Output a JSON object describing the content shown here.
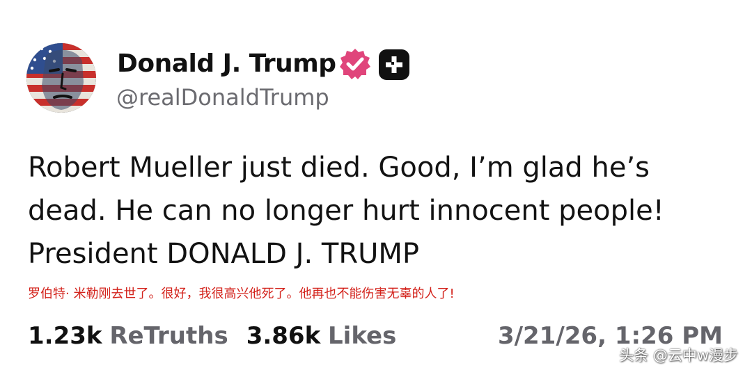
{
  "profile": {
    "display_name": "Donald J. Trump",
    "handle": "@realDonaldTrump",
    "verified_color": "#e0457b",
    "badge_color": "#111111"
  },
  "post": {
    "lines": [
      "Robert Mueller just died. Good, I’m glad he’s",
      "dead. He can no longer hurt innocent people!",
      "President DONALD J. TRUMP"
    ],
    "translation": "罗伯特· 米勒刚去世了。很好，我很高兴他死了。他再也不能伤害无辜的人了!"
  },
  "stats": {
    "retruths_count": "1.23k",
    "retruths_label": "ReTruths",
    "likes_count": "3.86k",
    "likes_label": "Likes",
    "timestamp": "3/21/26, 1:26 PM"
  },
  "watermark": {
    "text": "头条 @云中w漫步"
  },
  "colors": {
    "text": "#121212",
    "muted": "#65656b",
    "translation": "#d3221b"
  }
}
